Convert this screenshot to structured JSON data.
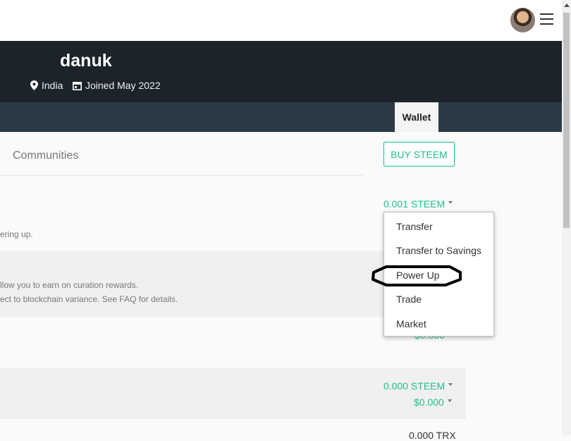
{
  "profile": {
    "username": "danuk",
    "location": "India",
    "joined": "Joined May 2022"
  },
  "tabs": {
    "wallet": "Wallet"
  },
  "subnav": {
    "communities": "Communities"
  },
  "actions": {
    "buy_steem": "BUY STEEM"
  },
  "wallet": {
    "steem_balance": "0.001 STEEM",
    "steem_desc_fragment": "ering up.",
    "sp_desc_line1": "llow you to earn on curation rewards.",
    "sp_desc_line2": "ect to blockchain variance. See FAQ for details.",
    "hidden_value": "$0.000",
    "savings_steem": "0.000 STEEM",
    "savings_usd": "$0.000",
    "bottom_value": "0.000 TRX"
  },
  "dropdown": {
    "items": [
      "Transfer",
      "Transfer to Savings",
      "Power Up",
      "Trade",
      "Market"
    ],
    "highlighted": "Power Up"
  },
  "colors": {
    "accent": "#1fbf8f",
    "banner": "#1c232b",
    "tabbar": "#2c3a46"
  },
  "icons": {
    "location": "map-pin-icon",
    "joined": "calendar-icon",
    "menu": "hamburger-menu-icon"
  }
}
